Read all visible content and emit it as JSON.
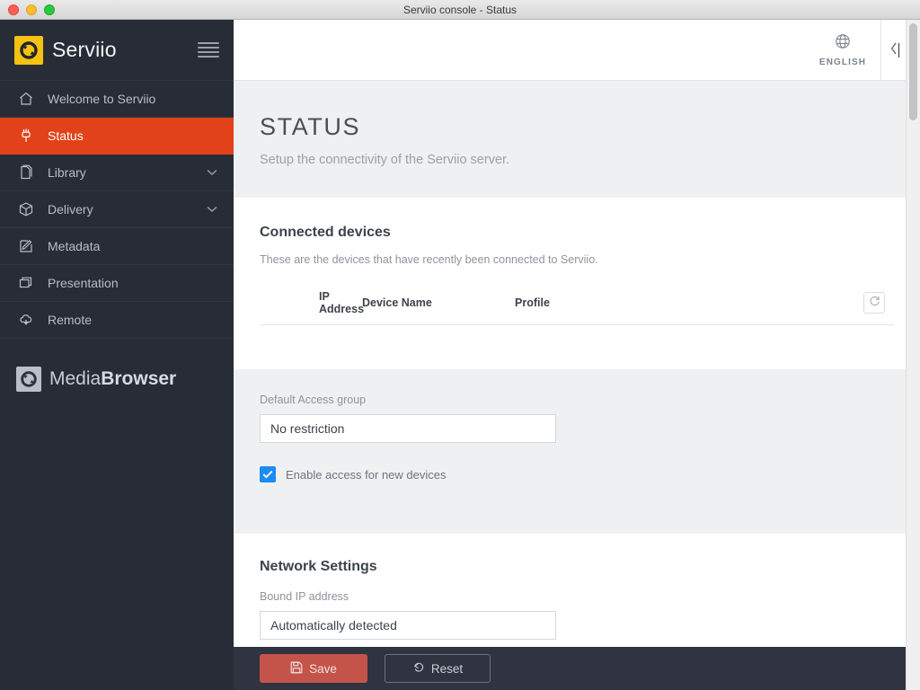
{
  "window": {
    "title": "Serviio console - Status",
    "traffic_lights": [
      "close",
      "minimize",
      "zoom"
    ]
  },
  "sidebar": {
    "brand": {
      "name": "Serviio",
      "logo_icon": "serviio-circular-arrows-icon",
      "menu_icon": "hamburger-menu-icon"
    },
    "items": [
      {
        "label": "Welcome to Serviio",
        "icon": "home-icon",
        "active": false,
        "expandable": false
      },
      {
        "label": "Status",
        "icon": "plug-icon",
        "active": true,
        "expandable": false
      },
      {
        "label": "Library",
        "icon": "documents-icon",
        "active": false,
        "expandable": true
      },
      {
        "label": "Delivery",
        "icon": "box-icon",
        "active": false,
        "expandable": true
      },
      {
        "label": "Metadata",
        "icon": "pencil-edit-icon",
        "active": false,
        "expandable": false
      },
      {
        "label": "Presentation",
        "icon": "windows-icon",
        "active": false,
        "expandable": false
      },
      {
        "label": "Remote",
        "icon": "cloud-down-icon",
        "active": false,
        "expandable": false
      }
    ],
    "footer": {
      "product_prefix": "Media",
      "product_suffix": "Browser",
      "logo_icon": "mediabrowser-circular-arrows-icon"
    },
    "colors": {
      "background": "#272c36",
      "active": "#e24219",
      "text": "#b9bdc6"
    }
  },
  "topbar": {
    "language_label": "ENGLISH",
    "language_icon": "globe-icon",
    "collapse_icon": "chevron-left-icon"
  },
  "header": {
    "title": "STATUS",
    "subtitle": "Setup the connectivity of the Serviio server."
  },
  "connected_devices": {
    "title": "Connected devices",
    "description": "These are the devices that have recently been connected to Serviio.",
    "columns": [
      "IP Address",
      "Device Name",
      "Profile"
    ],
    "rows": [],
    "refresh_icon": "refresh-icon"
  },
  "access": {
    "group_label": "Default Access group",
    "group_value": "No restriction",
    "checkbox_label": "Enable access for new devices",
    "checkbox_checked": true,
    "checkbox_color": "#1b8cf3"
  },
  "network": {
    "title": "Network Settings",
    "bound_ip_label": "Bound IP address",
    "bound_ip_value": "Automatically detected"
  },
  "footer": {
    "save_label": "Save",
    "save_icon": "floppy-disk-icon",
    "reset_label": "Reset",
    "reset_icon": "undo-arrow-icon",
    "save_color": "#c4544a"
  }
}
